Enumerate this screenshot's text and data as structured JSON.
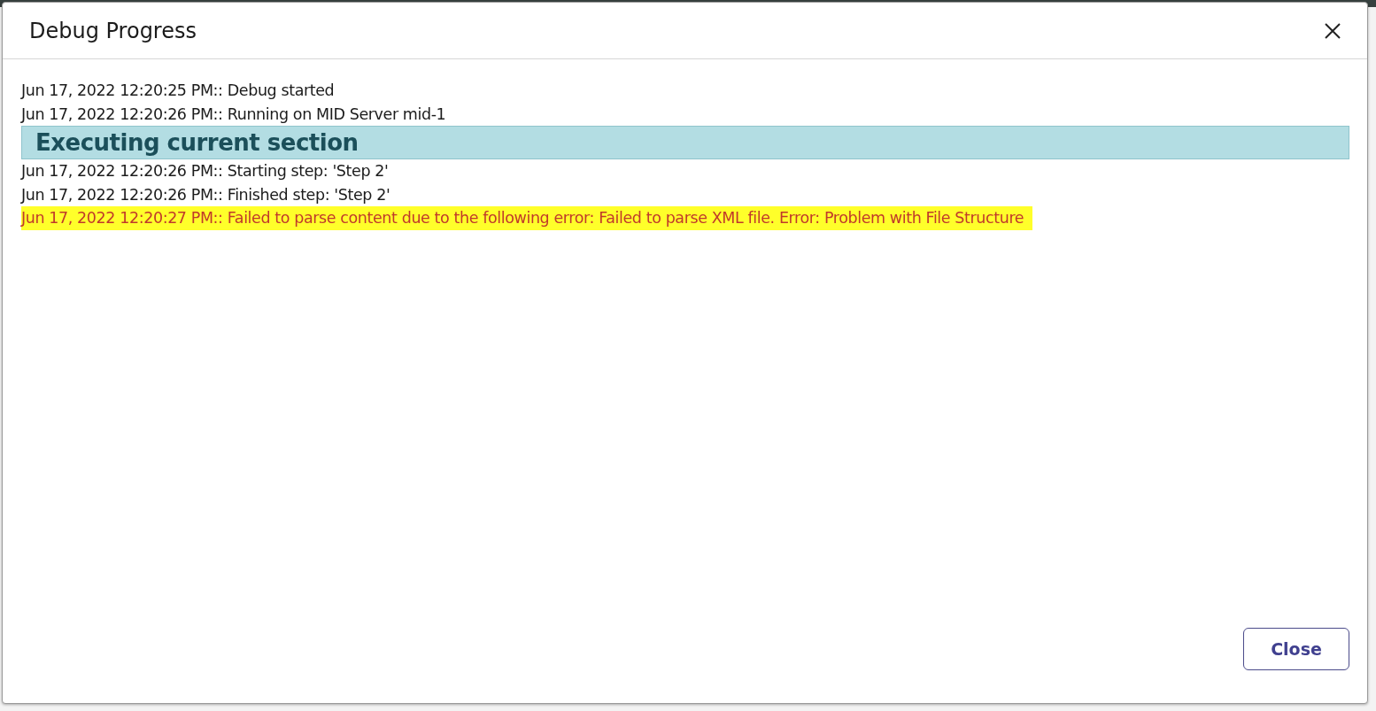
{
  "dialog": {
    "title": "Debug Progress",
    "log": [
      {
        "kind": "entry",
        "text": "Jun 17, 2022 12:20:25 PM:: Debug started",
        "error": false,
        "highlighted": false
      },
      {
        "kind": "entry",
        "text": "Jun 17, 2022 12:20:26 PM:: Running on MID Server mid-1",
        "error": false,
        "highlighted": false
      },
      {
        "kind": "section",
        "text": "Executing current section"
      },
      {
        "kind": "entry",
        "text": "Jun 17, 2022 12:20:26 PM:: Starting step: 'Step 2'",
        "error": false,
        "highlighted": false
      },
      {
        "kind": "entry",
        "text": "Jun 17, 2022 12:20:26 PM:: Finished step: 'Step 2'",
        "error": false,
        "highlighted": false
      },
      {
        "kind": "entry",
        "text": "Jun 17, 2022 12:20:27 PM:: Failed to parse content due to the following error: Failed to parse XML file. Error: Problem with File Structure",
        "error": true,
        "highlighted": true
      }
    ],
    "buttons": [
      "Close"
    ]
  }
}
